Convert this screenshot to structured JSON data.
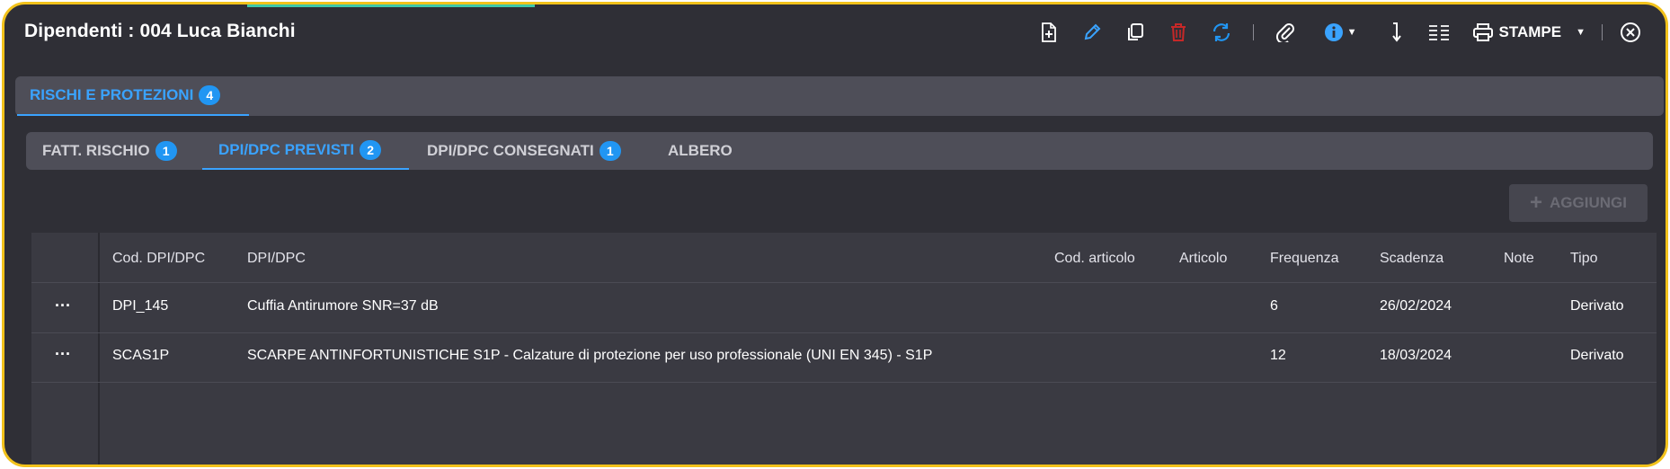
{
  "header": {
    "title": "Dipendenti : 004 Luca Bianchi",
    "toolbar": {
      "new_icon": "file-plus-icon",
      "edit_icon": "pencil-icon",
      "copy_icon": "copy-icon",
      "delete_icon": "trash-icon",
      "refresh_icon": "refresh-icon",
      "attach_icon": "paperclip-icon",
      "info_icon": "info-icon",
      "sort_icon": "sort-arrow-icon",
      "columns_icon": "list-columns-icon",
      "print_label": "STAMPE",
      "close_icon": "close-circle-icon"
    },
    "colors": {
      "accent": "#3aa3ff",
      "delete": "#c62828",
      "refresh": "#2196f3",
      "frame": "#f2c21b"
    }
  },
  "outer_tabs": [
    {
      "label": "RISCHI E PROTEZIONI",
      "badge": "4",
      "active": true
    }
  ],
  "inner_tabs": [
    {
      "label": "FATT. RISCHIO",
      "badge": "1",
      "active": false
    },
    {
      "label": "DPI/DPC PREVISTI",
      "badge": "2",
      "active": true
    },
    {
      "label": "DPI/DPC CONSEGNATI",
      "badge": "1",
      "active": false
    },
    {
      "label": "ALBERO",
      "badge": "",
      "active": false
    }
  ],
  "add_button": {
    "label": "AGGIUNGI",
    "icon": "plus-icon",
    "enabled": false
  },
  "table": {
    "columns": [
      "Cod. DPI/DPC",
      "DPI/DPC",
      "Cod. articolo",
      "Articolo",
      "Frequenza",
      "Scadenza",
      "Note",
      "Tipo"
    ],
    "rows": [
      {
        "actions": "...",
        "cod": "DPI_145",
        "dpi": "Cuffia Antirumore SNR=37 dB",
        "cod_articolo": "",
        "articolo": "",
        "frequenza": "6",
        "scadenza": "26/02/2024",
        "note": "",
        "tipo": "Derivato"
      },
      {
        "actions": "...",
        "cod": "SCAS1P",
        "dpi": "SCARPE ANTINFORTUNISTICHE S1P - Calzature di protezione per uso professionale (UNI EN 345) - S1P",
        "cod_articolo": "",
        "articolo": "",
        "frequenza": "12",
        "scadenza": "18/03/2024",
        "note": "",
        "tipo": "Derivato"
      }
    ]
  }
}
